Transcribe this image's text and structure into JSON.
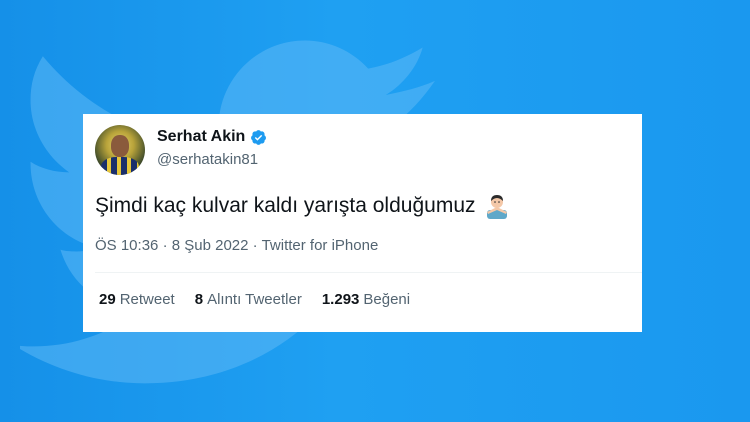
{
  "tweet": {
    "display_name": "Serhat Akin",
    "handle": "@serhatakin81",
    "verified": true,
    "text": "Şimdi kaç kulvar kaldı yarışta olduğumuz",
    "emoji": "man-gesturing-no-emoji",
    "time": "ÖS 10:36",
    "sep1": "·",
    "date": "8 Şub 2022",
    "sep2": "·",
    "source": "Twitter for iPhone"
  },
  "stats": {
    "retweets_count": "29",
    "retweets_label": "Retweet",
    "quotes_count": "8",
    "quotes_label": "Alıntı Tweetler",
    "likes_count": "1.293",
    "likes_label": "Beğeni"
  },
  "colors": {
    "background": "#1d9bf0",
    "verified": "#1d9bf0",
    "text": "#0f1419",
    "secondary": "#536471"
  }
}
